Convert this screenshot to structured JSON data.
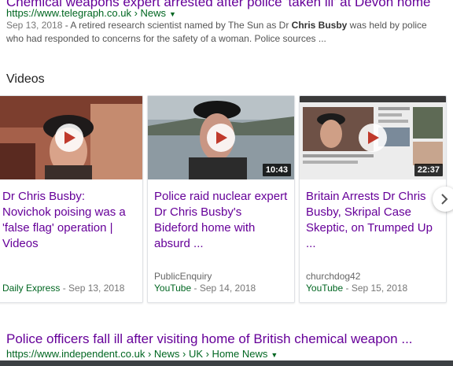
{
  "result1": {
    "title": "Chemical weapons expert arrested after police 'taken ill' at Devon home",
    "url": "https://www.telegraph.co.uk › News",
    "date": "Sep 13, 2018",
    "snippet_before": " - A retired research scientist named by The Sun as Dr ",
    "snippet_bold": "Chris Busby",
    "snippet_after": " was held by police who had responded to concerns for the safety of a woman. Police sources ..."
  },
  "videos": {
    "heading": "Videos",
    "cards": [
      {
        "title": "Dr Chris Busby: Novichok poising was a 'false flag' operation | Videos",
        "source": "",
        "publisher": "Daily Express",
        "date": " - Sep 13, 2018",
        "duration": ""
      },
      {
        "title": "Police raid nuclear expert Dr Chris Busby's Bideford home with absurd ...",
        "source": "PublicEnquiry",
        "publisher": "YouTube",
        "date": " - Sep 14, 2018",
        "duration": "10:43"
      },
      {
        "title": "Britain Arrests Dr Chris Busby, Skripal Case Skeptic, on Trumped Up ...",
        "source": "churchdog42",
        "publisher": "YouTube",
        "date": " - Sep 15, 2018",
        "duration": "22:37"
      }
    ]
  },
  "result2": {
    "title": "Police officers fall ill after visiting home of British chemical weapon ...",
    "url": "https://www.independent.co.uk › News › UK › Home News"
  },
  "icons": {
    "play": "play-icon",
    "next": "chevron-right-icon",
    "dropdown": "caret-down-icon"
  },
  "colors": {
    "link_visited": "#660099",
    "url_green": "#006621",
    "snippet": "#545454"
  }
}
